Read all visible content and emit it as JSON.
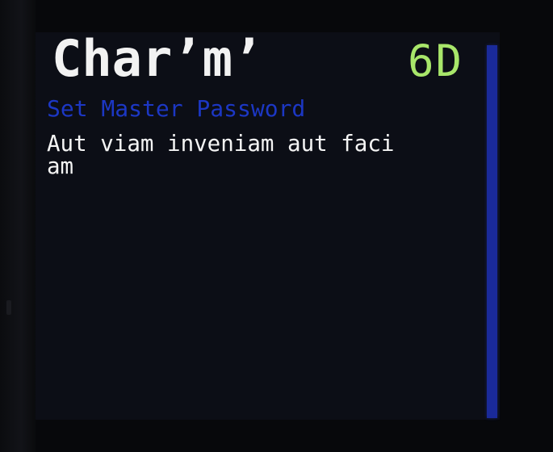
{
  "header": {
    "app_title": "Char’m’",
    "status_indicator": "6D"
  },
  "menu": {
    "selected_item": "Set Master Password"
  },
  "content": {
    "text_line_1": "Aut viam inveniam aut faci",
    "text_line_2": "am"
  },
  "colors": {
    "background": "#0c0e16",
    "title": "#f2f2f2",
    "status": "#a8e66a",
    "menu_highlight": "#1c37c4",
    "scrollbar": "#1a2a9a",
    "body_text": "#f4f4f4"
  }
}
